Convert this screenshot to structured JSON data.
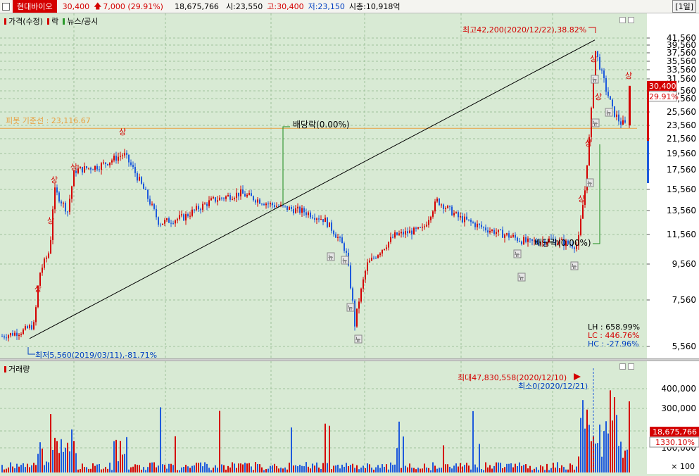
{
  "header": {
    "stock_name": "현대바이오",
    "price": "30,400",
    "change": "7,000",
    "change_pct": "(29.91%)",
    "volume": "18,675,766",
    "open": "시:23,550",
    "high": "고:30,400",
    "low": "저:23,150",
    "market_cap": "시총:10,918억",
    "period": "[1일]"
  },
  "price_panel": {
    "legend_price": "가격(수정)",
    "legend_drop": "락",
    "legend_news": "뉴스/공시",
    "pivot_label": "피봇 기준선 : 23,116.67",
    "high_annotation": "최고42,200(2020/12/22),38.82%",
    "low_annotation": "최저5,560(2019/03/11),-81.71%",
    "dividend_label_1": "배당락(0.00%)",
    "dividend_label_2": "배당락(0.00%)",
    "limit_up": "상",
    "news_tag": "뉴",
    "lh": "LH : 658.99%",
    "lc": "LC : 446.76%",
    "hc": "HC : -27.96%",
    "price_box": "30,400",
    "pct_box": "29.91%",
    "y_ticks": [
      "41,560",
      "39,560",
      "37,560",
      "35,560",
      "33,560",
      "31,560",
      "29,560",
      "27,560",
      "25,560",
      "23,560",
      "21,560",
      "19,560",
      "17,560",
      "15,560",
      "13,560",
      "11,560",
      "9,560",
      "7,560",
      "5,560"
    ],
    "colors": {
      "up": "#d40000",
      "down": "#1e5adc",
      "pivot": "#e8a040",
      "trend": "#000000",
      "grid": "#9fc29b"
    }
  },
  "volume_panel": {
    "legend": "거래량",
    "max_annotation": "최대47,830,558(2020/12/10)",
    "min_annotation": "최소0(2020/12/21)",
    "volume_box": "18,675,766",
    "pct_box": "1330.10%",
    "unit": "× 100",
    "y_ticks": [
      "400,000",
      "300,000",
      "200,000",
      "100,000"
    ]
  },
  "chart_data": {
    "type": "candlestick",
    "x_range": [
      "2018",
      "2021/01"
    ],
    "ylim": [
      5560,
      42200
    ],
    "pivot": 23116.67,
    "series_high": {
      "value": 42200,
      "date": "2020/12/22"
    },
    "series_low": {
      "value": 5560,
      "date": "2019/03/11"
    },
    "last": {
      "open": 23550,
      "high": 30400,
      "low": 23150,
      "close": 30400
    },
    "volume_max": 47830558
  }
}
